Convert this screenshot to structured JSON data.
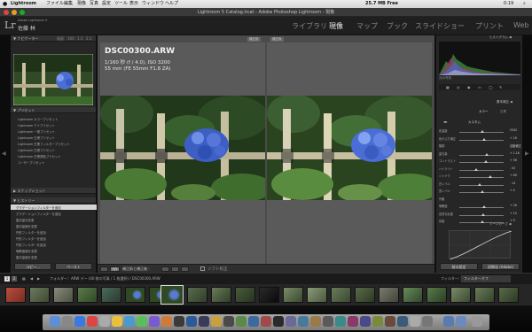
{
  "menubar": {
    "app": "Lightroom",
    "items": [
      "ファイル",
      "編集",
      "現像",
      "写真",
      "設定",
      "ツール",
      "表示",
      "ウィンドウ",
      "ヘルプ"
    ],
    "status": "25.7 MB Free",
    "time": "0:19"
  },
  "window": {
    "title": "Lightroom 5 Catalog.lrcat - Adobe Photoshop Lightroom - 現像"
  },
  "identity": {
    "logo": "Lr",
    "product": "Adobe Lightroom 5",
    "user": "佐藤 林",
    "modules": [
      "ライブラリ",
      "現像",
      "マップ",
      "ブック",
      "スライドショー",
      "プリント",
      "Web"
    ],
    "active_module": "現像"
  },
  "left_panel": {
    "navigator": {
      "title": "▼ ナビゲーター",
      "zoom_options": [
        "画面",
        "100",
        "1:1",
        "2:1"
      ]
    },
    "presets": {
      "title": "▼ プリセット",
      "items": [
        "Lightroom カラープリセット",
        "Lightroom アイプリセット",
        "Lightroom 一般プリセット",
        "Lightroom 白黒プリセット",
        "Lightroom 白黒フィルタープリセット",
        "Lightroom 白黒プリセット",
        "Lightroom 白黒調色プリセット",
        "ユーザープリセット"
      ]
    },
    "snapshots": {
      "title": "▶ スナップショット"
    },
    "history": {
      "title": "▼ ヒストリー",
      "items": [
        "グラデーションフィルターを追加",
        "グラデーションフィルターを追加",
        "露光量を変更",
        "露光量値を変更",
        "円形フィルターを追加",
        "円形フィルターを追加",
        "円形フィルターを追加",
        "明瞭度値を変更",
        "露光量値を変更"
      ]
    },
    "copy_button": "コピー...",
    "paste_button": "ペースト"
  },
  "image_info": {
    "filename": "DSC00300.ARW",
    "exposure": "1/160 秒 (f / 4.0), ISO 3200",
    "lens": "55 mm (FE 55mm F1.8 ZA)"
  },
  "compare": {
    "before_label": "補正前",
    "after_label": "補正後"
  },
  "toolbar": {
    "view_label": "Y|Y",
    "mode_label": "補正前と補正後 :",
    "softproof": "ソフト校正"
  },
  "right_panel": {
    "histogram": {
      "title": "ヒストグラム ◀",
      "original_label": "元の写真"
    },
    "basic": {
      "title": "基本補正 ◀",
      "treatment_color": "カラー",
      "treatment_bw": "白黒",
      "profile": "カスタム",
      "sliders": [
        {
          "label": "色温度",
          "value": "5342",
          "pos": 0.52
        },
        {
          "label": "色かぶり補正",
          "value": "+ 16",
          "pos": 0.56
        },
        {
          "label": "階調",
          "value": "自動補正",
          "pos": null
        },
        {
          "label": "露光量",
          "value": "+ 1.16",
          "pos": 0.62
        },
        {
          "label": "コントラスト",
          "value": "+ 36",
          "pos": 0.6
        },
        {
          "label": "ハイライト",
          "value": "- 52",
          "pos": 0.38
        },
        {
          "label": "シャドウ",
          "value": "+ 69",
          "pos": 0.7
        },
        {
          "label": "白レベル",
          "value": "- 14",
          "pos": 0.46
        },
        {
          "label": "黒レベル",
          "value": "+ 4",
          "pos": 0.51
        },
        {
          "label": "外観",
          "value": "",
          "pos": null
        },
        {
          "label": "明瞭度",
          "value": "+ 26",
          "pos": 0.56
        },
        {
          "label": "自然な彩度",
          "value": "+ 15",
          "pos": 0.54
        },
        {
          "label": "彩度",
          "value": "+ 9",
          "pos": 0.52
        }
      ]
    },
    "tone_curve": {
      "title": "トーンカーブ ◀"
    },
    "prev_button": "前の設定",
    "reset_button": "初期化 (Adobe)"
  },
  "filmstrip_bar": {
    "pages": [
      "1",
      "2"
    ],
    "path": "フォルダー：ARW デー (40 枚の写真 / 1 枚選択) / DSC00300.ARW",
    "filter_label": "フィルター：",
    "filter_value": "フィルターオフ"
  },
  "colors": {
    "accent_blue": "#5b7fe0",
    "panel": "#262626",
    "center": "#4b4b4b"
  }
}
